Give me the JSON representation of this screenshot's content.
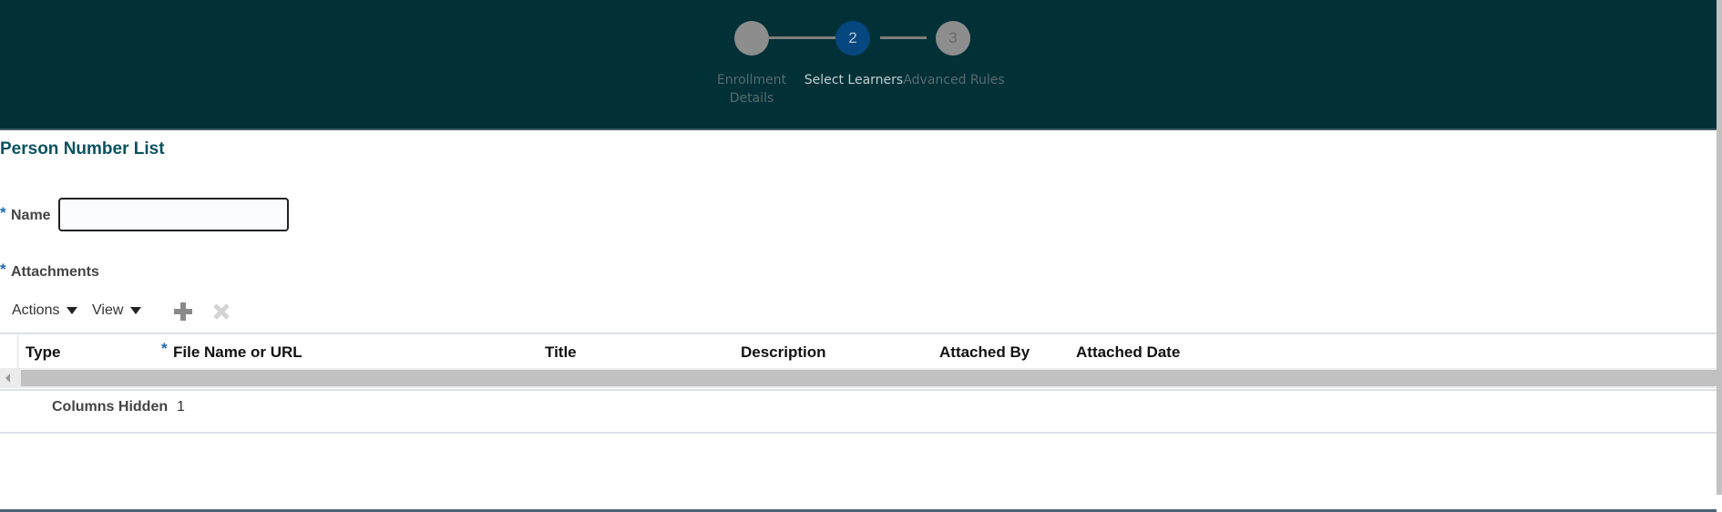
{
  "train": {
    "steps": [
      {
        "number": "",
        "label_line1": "Enrollment",
        "label_line2": "Details"
      },
      {
        "number": "2",
        "label": "Select Learners"
      },
      {
        "number": "3",
        "label": "Advanced Rules"
      }
    ]
  },
  "section_title": "Person Number List",
  "form": {
    "required_mark": "*",
    "name_label": "Name",
    "name_value": "",
    "attachments_label": "Attachments"
  },
  "toolbar": {
    "actions_label": "Actions",
    "view_label": "View"
  },
  "table": {
    "columns": [
      "Type",
      "File Name or URL",
      "Title",
      "Description",
      "Attached By",
      "Attached Date"
    ],
    "columns_hidden_label": "Columns Hidden",
    "columns_hidden_count": "1"
  }
}
